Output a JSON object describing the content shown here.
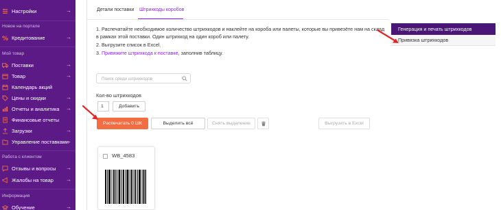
{
  "sidebar": {
    "items_top": [
      {
        "label": "Настройки",
        "icon": "sliders-icon"
      }
    ],
    "section_new": "Новое на портале",
    "new_items": [
      {
        "label": "Кредитование",
        "icon": "percent-icon"
      }
    ],
    "section_my": "Мой товар",
    "my_items": [
      {
        "label": "Поставки",
        "icon": "truck-icon"
      },
      {
        "label": "Товар",
        "icon": "box-icon"
      },
      {
        "label": "Календарь акций",
        "icon": "calendar-icon"
      },
      {
        "label": "Цены и скидки",
        "icon": "tag-icon"
      },
      {
        "label": "Отчеты и аналитика",
        "icon": "chart-icon"
      },
      {
        "label": "Финансовые отчеты",
        "icon": "document-icon"
      },
      {
        "label": "Загрузки",
        "icon": "upload-icon"
      },
      {
        "label": "Управление поставками",
        "icon": "folder-icon"
      }
    ],
    "section_client": "Работа с клиентом",
    "client_items": [
      {
        "label": "Отзывы и вопросы",
        "icon": "chat-icon"
      },
      {
        "label": "Жалобы на товар",
        "icon": "megaphone-icon"
      }
    ],
    "section_info": "Информация",
    "info_items": [
      {
        "label": "Обучение",
        "icon": "education-icon"
      }
    ]
  },
  "tabs": {
    "details": "Детали поставки",
    "barcodes": "Штрихкоды коробов"
  },
  "instructions": {
    "line1a": "1. Распечатайте необходимое количество штрихкодов и наклейте на короба или палеты, которые вы привезёте нам на склад",
    "line1b": "в рамках этой поставки. Один штрихкод на один короб или палету.",
    "line2": "2. Выгрузите список в Excel.",
    "line3_prefix": "3. ",
    "line3_link": "Привяжите штрихкода к поставке",
    "line3_suffix": ", заполнив таблицу."
  },
  "menu": {
    "generate": "Генерация и печать штрихкодов",
    "bind": "Привязка штрихкодов"
  },
  "search": {
    "placeholder": "Поиск среди штрихкодов"
  },
  "quantity": {
    "label": "Кол-во штрихкодов",
    "value": "1",
    "add_button": "Добавить"
  },
  "actions": {
    "print": "Распечатать 0 ШК",
    "select_all": "Выделить всё",
    "clear_selection": "Снять выделение",
    "export_excel": "Выгрузить в Excel"
  },
  "barcode_card": {
    "code": "WB_4583"
  },
  "colors": {
    "sidebar_bg": "#5b1a86",
    "accent_purple": "#8e1ff0",
    "menu_dark": "#4a1677",
    "primary_orange": "#f26d42",
    "arrow_red": "#e0262b"
  }
}
